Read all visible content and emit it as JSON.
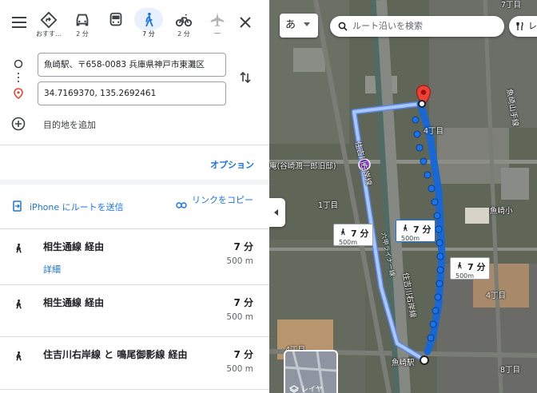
{
  "modes": [
    {
      "name": "best-mode",
      "label": "おすす…"
    },
    {
      "name": "drive-mode",
      "label": "2 分"
    },
    {
      "name": "transit-mode",
      "label": ""
    },
    {
      "name": "walk-mode",
      "label": "7 分"
    },
    {
      "name": "bike-mode",
      "label": "2 分"
    },
    {
      "name": "flight-mode",
      "label": "—"
    }
  ],
  "origin": {
    "value": "魚崎駅、〒658-0083 兵庫県神戸市東灘区"
  },
  "destination": {
    "value": "34.7169370, 135.2692461"
  },
  "add_destination": "目的地を追加",
  "options_label": "オプション",
  "send_to_iphone": "iPhone にルートを送信",
  "copy_link": "リンクをコピー",
  "routes": [
    {
      "name": "相生通線 経由",
      "time": "7 分",
      "distance": "500 m",
      "detail": "詳細"
    },
    {
      "name": "相生通線 経由",
      "time": "7 分",
      "distance": "500 m",
      "detail": ""
    },
    {
      "name": "住吉川右岸線 と 鳴尾御影線 経由",
      "time": "7 分",
      "distance": "500 m",
      "detail": ""
    }
  ],
  "map": {
    "lang_button": "あ",
    "search_placeholder": "ルート沿いを検索",
    "chip_label": "レ",
    "bubbles": [
      {
        "time": "7 分",
        "distance": "500m"
      },
      {
        "time": "7 分",
        "distance": "500m"
      },
      {
        "time": "7 分",
        "distance": "500m"
      }
    ],
    "labels": {
      "place_poi": "庵(谷崎潤一郎旧邸)",
      "road_left": "住吉川左岸線",
      "road_right": "住吉川右岸線",
      "road_liner": "六甲ライナー線",
      "road_ns": "魚崎山手線",
      "area_1": "1丁目",
      "area_4a": "4丁目",
      "area_4b": "4丁目",
      "area_4c": "4丁目",
      "area_8": "8丁目",
      "station": "魚崎駅",
      "poi_right": "魚崎小",
      "top_right": "7丁目",
      "layer_label": "レイヤ"
    }
  },
  "colors": {
    "accent": "#1a73e8",
    "route": "#1967d2",
    "alt_route": "#a8c7fa",
    "pin": "#ea4335"
  }
}
